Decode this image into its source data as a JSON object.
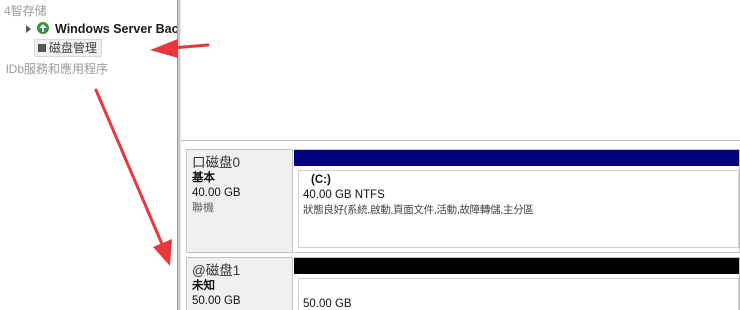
{
  "tree": {
    "storage_label": "4智存储",
    "windows_server_backup": "Windows Server Back",
    "disk_management": "磁盘管理",
    "services_label": "lDb服務和應用程序"
  },
  "disks": [
    {
      "name": "口磁盘0",
      "type": "基本",
      "size": "40.00 GB",
      "status": "聯機",
      "bar_color": "#000080",
      "partition": {
        "name": "(C:)",
        "size_fs": "40.00 GB NTFS",
        "status": "狀態良好(系統,啟動,頁面文件,活動,故障轉儲,主分區"
      }
    },
    {
      "name": "@磁盘1",
      "type": "未知",
      "size": "50.00 GB",
      "bar_color": "#000000",
      "partition": {
        "size_fs": "50.00 GB"
      }
    }
  ],
  "colors": {
    "annotation_arrow": "#e8383d",
    "primary_partition_bar": "#000080",
    "unallocated_bar": "#000000"
  }
}
